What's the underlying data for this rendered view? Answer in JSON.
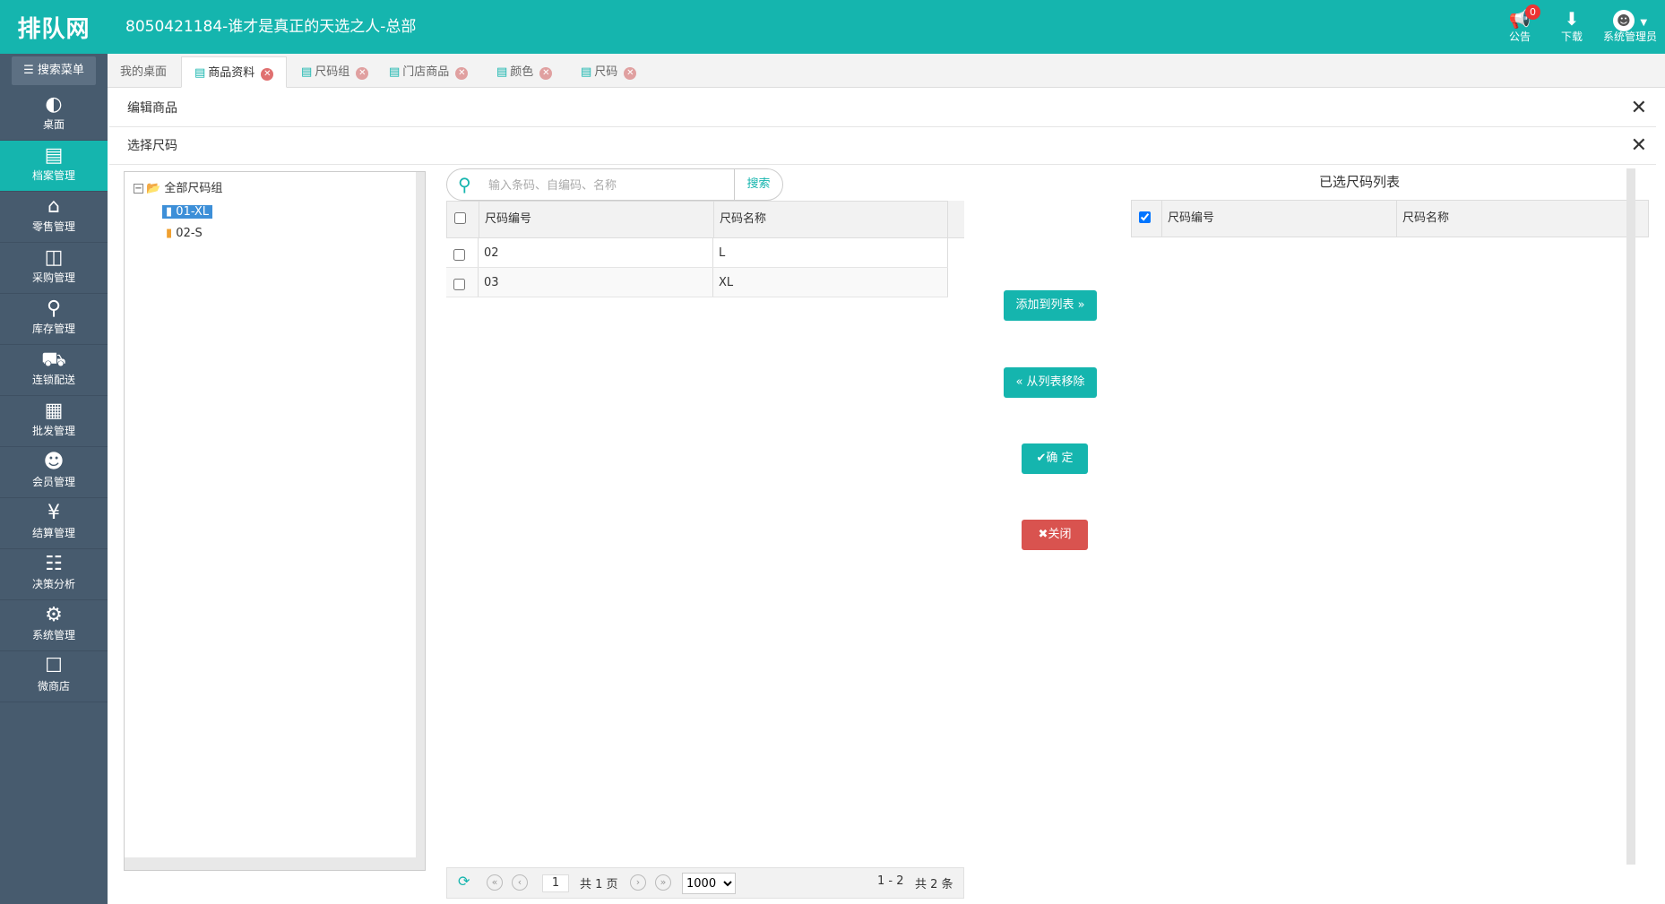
{
  "app": {
    "logo": "排队网",
    "title": "8050421184-谁才是真正的天选之人-总部",
    "notice_label": "公告",
    "notice_count": "0",
    "download_label": "下载",
    "user_label": "系统管理员"
  },
  "sidebar": {
    "search_menu": "搜索菜单",
    "items": [
      {
        "label": "桌面",
        "icon": "dashboard-icon"
      },
      {
        "label": "档案管理",
        "icon": "archive-icon"
      },
      {
        "label": "零售管理",
        "icon": "store-icon"
      },
      {
        "label": "采购管理",
        "icon": "cart-icon"
      },
      {
        "label": "库存管理",
        "icon": "inventory-icon"
      },
      {
        "label": "连锁配送",
        "icon": "truck-icon"
      },
      {
        "label": "批发管理",
        "icon": "wholesale-icon"
      },
      {
        "label": "会员管理",
        "icon": "member-icon"
      },
      {
        "label": "结算管理",
        "icon": "settlement-icon"
      },
      {
        "label": "决策分析",
        "icon": "analytics-icon"
      },
      {
        "label": "系统管理",
        "icon": "gear-icon"
      },
      {
        "label": "微商店",
        "icon": "shop-icon"
      }
    ],
    "active_index": 1
  },
  "tabs": [
    {
      "label": "我的桌面",
      "closable": false
    },
    {
      "label": "商品资料",
      "closable": true
    },
    {
      "label": "尺码组",
      "closable": true
    },
    {
      "label": "门店商品",
      "closable": true
    },
    {
      "label": "颜色",
      "closable": true
    },
    {
      "label": "尺码",
      "closable": true
    }
  ],
  "panels": {
    "edit_title": "编辑商品",
    "select_title": "选择尺码"
  },
  "tree": {
    "root": "全部尺码组",
    "children": [
      "01-XL",
      "02-S"
    ],
    "selected": "01-XL"
  },
  "search": {
    "placeholder": "输入条码、自编码、名称",
    "button": "搜索"
  },
  "left_grid": {
    "headers": [
      "尺码编号",
      "尺码名称"
    ],
    "rows": [
      {
        "code": "02",
        "name": "L"
      },
      {
        "code": "03",
        "name": "XL"
      }
    ]
  },
  "actions": {
    "add": "添加到列表",
    "remove": "从列表移除",
    "confirm": "确 定",
    "close": "关闭"
  },
  "right_grid": {
    "title": "已选尺码列表",
    "headers": [
      "尺码编号",
      "尺码名称"
    ]
  },
  "pager": {
    "page": "1",
    "total_pages": "共 1 页",
    "page_size": "1000",
    "range": "1 - 2",
    "total": "共 2 条"
  },
  "colors": {
    "accent": "#15b5ae",
    "sidebar": "#475b6e",
    "danger": "#d9534f"
  }
}
